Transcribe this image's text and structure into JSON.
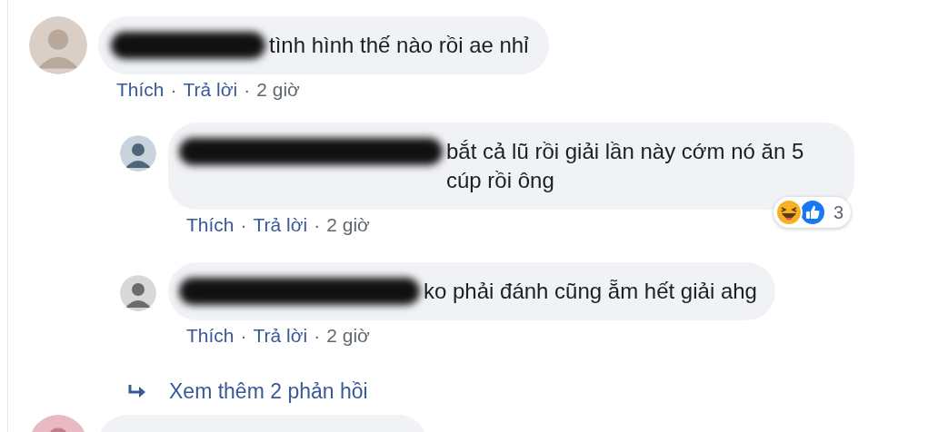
{
  "comments": [
    {
      "kind": "comment",
      "author_redacted": true,
      "text": "tình hình thế nào rồi ae nhỉ",
      "meta": [
        {
          "kind": "link",
          "text": "Thích"
        },
        {
          "kind": "dot",
          "text": "·"
        },
        {
          "kind": "link",
          "text": "Trả lời"
        },
        {
          "kind": "dot",
          "text": "·"
        },
        {
          "kind": "time",
          "text": "2 giờ"
        }
      ],
      "replies": [
        {
          "author_redacted": true,
          "text": "bắt cả lũ rồi giải lần này cớm nó ăn 5 cúp rồi ông",
          "meta": [
            {
              "kind": "link",
              "text": "Thích"
            },
            {
              "kind": "dot",
              "text": "·"
            },
            {
              "kind": "link",
              "text": "Trả lời"
            },
            {
              "kind": "dot",
              "text": "·"
            },
            {
              "kind": "time",
              "text": "2 giờ"
            }
          ],
          "reactions": {
            "icons": [
              {
                "kind": "haha"
              },
              {
                "kind": "like"
              }
            ],
            "count": "3"
          }
        },
        {
          "author_redacted": true,
          "text": "ko phải đánh cũng ẵm hết giải ahg",
          "meta": [
            {
              "kind": "link",
              "text": "Thích"
            },
            {
              "kind": "dot",
              "text": "·"
            },
            {
              "kind": "link",
              "text": "Trả lời"
            },
            {
              "kind": "dot",
              "text": "·"
            },
            {
              "kind": "time",
              "text": "2 giờ"
            }
          ]
        }
      ],
      "more_replies": "Xem thêm 2 phản hồi"
    },
    {
      "kind": "cut_off"
    }
  ]
}
